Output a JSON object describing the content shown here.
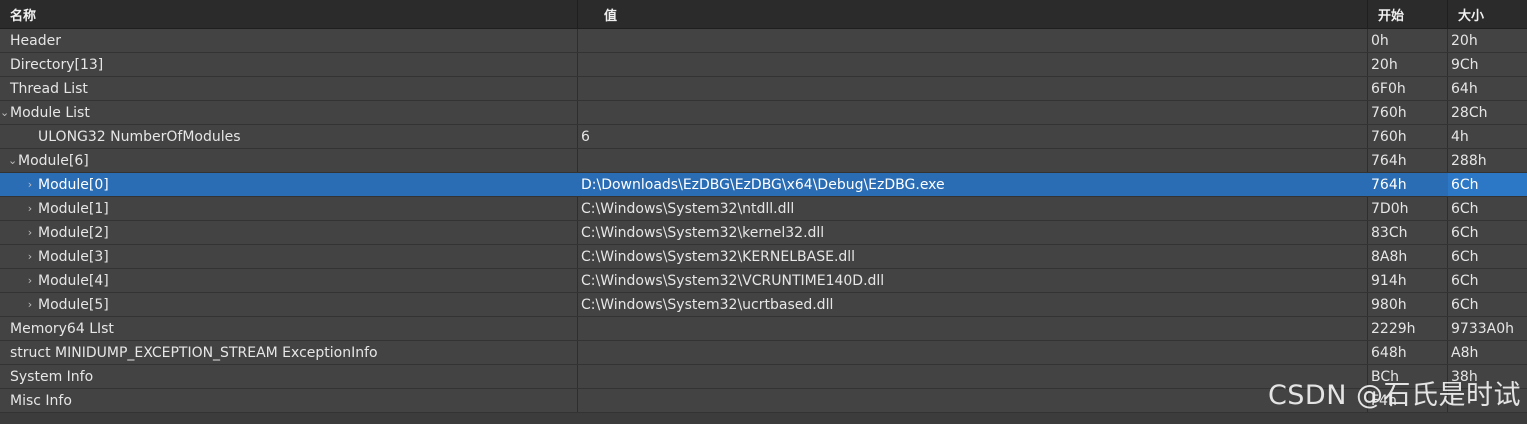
{
  "columns": {
    "name": "名称",
    "value": "值",
    "start": "开始",
    "size": "大小"
  },
  "rows": [
    {
      "name": "Header",
      "value": "",
      "start": "0h",
      "size": "20h",
      "arrow": "",
      "level": 0
    },
    {
      "name": "Directory[13]",
      "value": "",
      "start": "20h",
      "size": "9Ch",
      "arrow": "",
      "level": 0
    },
    {
      "name": "Thread List",
      "value": "",
      "start": "6F0h",
      "size": "64h",
      "arrow": "",
      "level": 0
    },
    {
      "name": "Module List",
      "value": "",
      "start": "760h",
      "size": "28Ch",
      "arrow": "⌄",
      "level": 0
    },
    {
      "name": "ULONG32 NumberOfModules",
      "value": "6",
      "start": "760h",
      "size": "4h",
      "arrow": "",
      "level": 2
    },
    {
      "name": "Module[6]",
      "value": "",
      "start": "764h",
      "size": "288h",
      "arrow": "⌄",
      "level": 1
    },
    {
      "name": "Module[0]",
      "value": "D:\\Downloads\\EzDBG\\EzDBG\\x64\\Debug\\EzDBG.exe",
      "start": "764h",
      "size": "6Ch",
      "arrow": "›",
      "level": 2,
      "selected": true
    },
    {
      "name": "Module[1]",
      "value": "C:\\Windows\\System32\\ntdll.dll",
      "start": "7D0h",
      "size": "6Ch",
      "arrow": "›",
      "level": 2
    },
    {
      "name": "Module[2]",
      "value": "C:\\Windows\\System32\\kernel32.dll",
      "start": "83Ch",
      "size": "6Ch",
      "arrow": "›",
      "level": 2
    },
    {
      "name": "Module[3]",
      "value": "C:\\Windows\\System32\\KERNELBASE.dll",
      "start": "8A8h",
      "size": "6Ch",
      "arrow": "›",
      "level": 2
    },
    {
      "name": "Module[4]",
      "value": "C:\\Windows\\System32\\VCRUNTIME140D.dll",
      "start": "914h",
      "size": "6Ch",
      "arrow": "›",
      "level": 2
    },
    {
      "name": "Module[5]",
      "value": "C:\\Windows\\System32\\ucrtbased.dll",
      "start": "980h",
      "size": "6Ch",
      "arrow": "›",
      "level": 2
    },
    {
      "name": "Memory64 LIst",
      "value": "",
      "start": "2229h",
      "size": "9733A0h",
      "arrow": "",
      "level": 0
    },
    {
      "name": "struct MINIDUMP_EXCEPTION_STREAM ExceptionInfo",
      "value": "",
      "start": "648h",
      "size": "A8h",
      "arrow": "",
      "level": 0
    },
    {
      "name": "System Info",
      "value": "",
      "start": "BCh",
      "size": "38h",
      "arrow": "",
      "level": 0
    },
    {
      "name": "Misc Info",
      "value": "",
      "start": "F4h",
      "size": "",
      "arrow": "",
      "level": 0
    }
  ],
  "watermark": "CSDN @石氏是时试",
  "colors": {
    "background": "#434343",
    "header": "#2b2b2b",
    "selected": "#2a6db5"
  }
}
